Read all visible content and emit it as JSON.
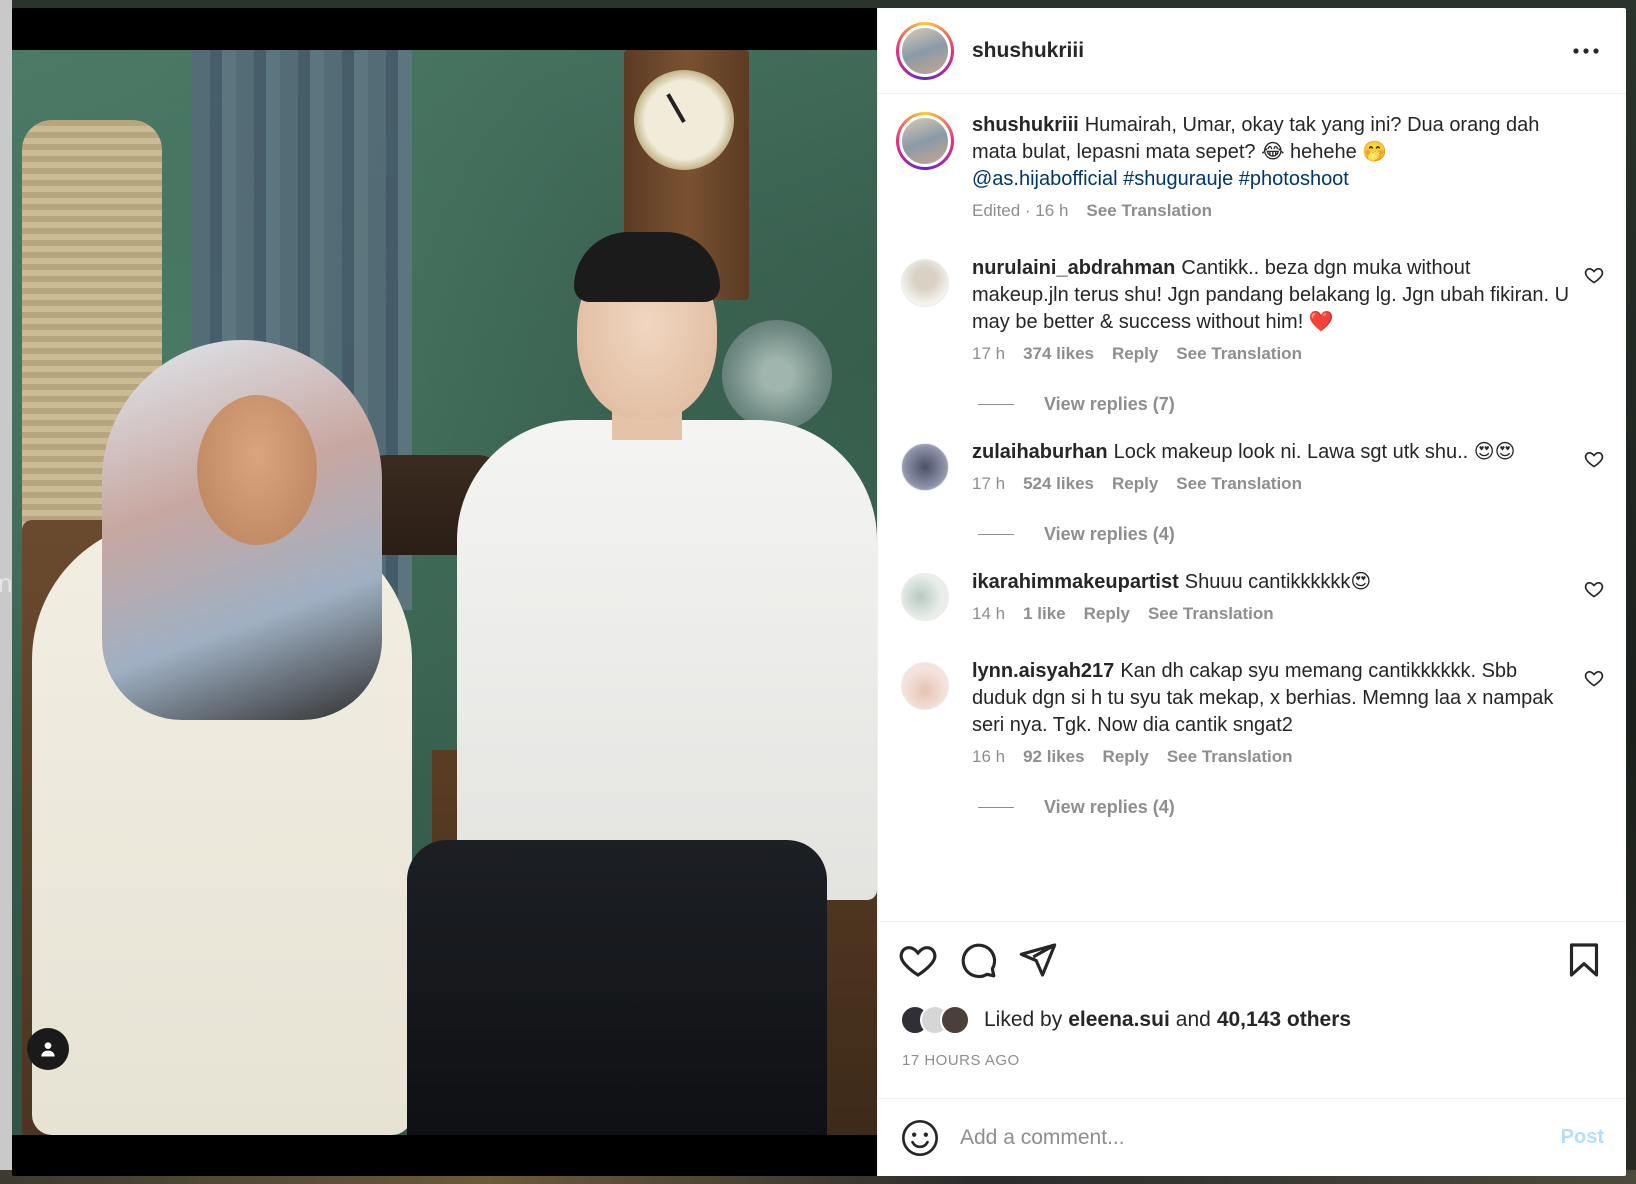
{
  "post": {
    "username": "shushukriii",
    "caption_text": "Humairah, Umar, okay tak yang ini? Dua orang dah mata bulat, lepasni mata sepet? 😂 hehehe 🤭",
    "caption_tags": "@as.hijabofficial #shugurauje #photoshoot",
    "caption_meta_edited": "Edited · 16 h",
    "caption_meta_translation": "See Translation"
  },
  "comments": [
    {
      "username": "nurulaini_abdrahman",
      "text": "Cantikk.. beza dgn muka without makeup.jln terus shu! Jgn pandang belakang lg. Jgn ubah fikiran. U may be better & success without him! ❤️",
      "time": "17 h",
      "likes": "374 likes",
      "reply": "Reply",
      "translation": "See Translation",
      "view_replies": "View replies (7)"
    },
    {
      "username": "zulaihaburhan",
      "text": "Lock makeup look ni. Lawa sgt utk shu.. 😍😍",
      "time": "17 h",
      "likes": "524 likes",
      "reply": "Reply",
      "translation": "See Translation",
      "view_replies": "View replies (4)"
    },
    {
      "username": "ikarahimmakeupartist",
      "text": "Shuuu cantikkkkkk😍",
      "time": "14 h",
      "likes": "1 like",
      "reply": "Reply",
      "translation": "See Translation"
    },
    {
      "username": "lynn.aisyah217",
      "text": "Kan dh cakap syu memang cantikkkkkk. Sbb duduk dgn si h tu syu tak mekap, x berhias. Memng laa x nampak seri nya. Tgk. Now dia cantik sngat2",
      "time": "16 h",
      "likes": "92 likes",
      "reply": "Reply",
      "translation": "See Translation",
      "view_replies": "View replies (4)"
    }
  ],
  "liked_by": {
    "prefix": "Liked by",
    "user": "eleena.sui",
    "and": "and",
    "others": "40,143 others"
  },
  "timestamp": "17 HOURS AGO",
  "comment_box": {
    "placeholder": "Add a comment...",
    "post_label": "Post"
  },
  "backdrop_letter": "n",
  "icons": {
    "more": "more-horizontal-icon",
    "heart": "heart-icon",
    "comment": "comment-icon",
    "share": "share-icon",
    "bookmark": "bookmark-icon",
    "emoji": "emoji-icon",
    "tag": "user-tag-icon"
  },
  "colors": {
    "link": "#00376b",
    "muted": "#8e8e8e",
    "post_disabled": "#b2dffc"
  }
}
